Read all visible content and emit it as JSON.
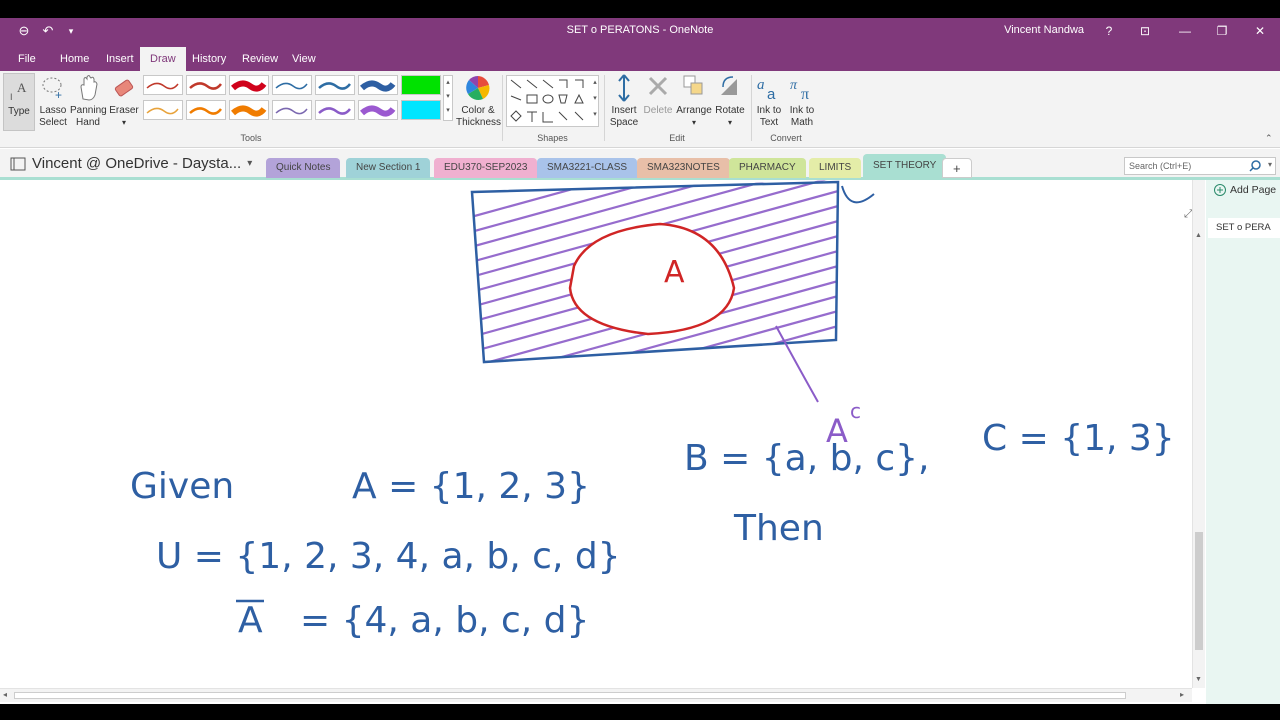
{
  "window": {
    "title": "SET o PERATONS - OneNote",
    "user": "Vincent Nandwa",
    "help": "?"
  },
  "ribbon_tabs": [
    {
      "label": "File"
    },
    {
      "label": "Home"
    },
    {
      "label": "Insert"
    },
    {
      "label": "Draw"
    },
    {
      "label": "History"
    },
    {
      "label": "Review"
    },
    {
      "label": "View"
    }
  ],
  "tools": {
    "type_label": "Type",
    "lasso_label_1": "Lasso",
    "lasso_label_2": "Select",
    "panning_label_1": "Panning",
    "panning_label_2": "Hand",
    "eraser_label": "Eraser",
    "group_label": "Tools",
    "pen_colors": [
      "#c0392b",
      "#c0392b",
      "#d0021b",
      "#2e6da4",
      "#2e6da4",
      "#2e5fa3",
      "#00e200",
      "#e8a33c",
      "#f07c00",
      "#f07c00",
      "#7b68b0",
      "#8b5cc8",
      "#9b59d0",
      "#00e5ff"
    ]
  },
  "color_thickness": {
    "label_1": "Color &",
    "label_2": "Thickness"
  },
  "shapes": {
    "group_label": "Shapes"
  },
  "edit": {
    "insert_space_1": "Insert",
    "insert_space_2": "Space",
    "delete_label": "Delete",
    "arrange_label": "Arrange",
    "rotate_label": "Rotate",
    "group_label": "Edit"
  },
  "convert": {
    "ink_to_text_1": "Ink to",
    "ink_to_text_2": "Text",
    "ink_to_math_1": "Ink to",
    "ink_to_math_2": "Math",
    "group_label": "Convert"
  },
  "notebook": {
    "name": "Vincent @ OneDrive - Daysta..."
  },
  "sections": [
    {
      "label": "Quick Notes",
      "color": "#b3a3d9"
    },
    {
      "label": "New Section 1",
      "color": "#9fd2d8"
    },
    {
      "label": "EDU370-SEP2023",
      "color": "#f0b0d0"
    },
    {
      "label": "SMA3221-CLASS",
      "color": "#a9c3ea"
    },
    {
      "label": "SMA323NOTES",
      "color": "#e8bfa8"
    },
    {
      "label": "PHARMACY",
      "color": "#cfe59a"
    },
    {
      "label": "LIMITS",
      "color": "#e4eda8"
    },
    {
      "label": "SET THEORY",
      "color": "#a9dfd2"
    }
  ],
  "add_section": "+",
  "search": {
    "placeholder": "Search (Ctrl+E)"
  },
  "page_pane": {
    "add_page": "Add Page",
    "pages": [
      {
        "label": "SET o PERA"
      }
    ]
  },
  "ink": {
    "circle_label": "A",
    "complement_label": "A",
    "complement_sup": "c",
    "given": "Given",
    "set_a": "A = {1, 2, 3}",
    "set_b": "B = {a, b, c},",
    "set_c": "C = {1, 3}",
    "universal": "U = {1, 2, 3, 4, a, b, c, d}",
    "then": "Then",
    "a_bar": "A",
    "a_bar_set": "= {4, a, b, c, d}"
  }
}
